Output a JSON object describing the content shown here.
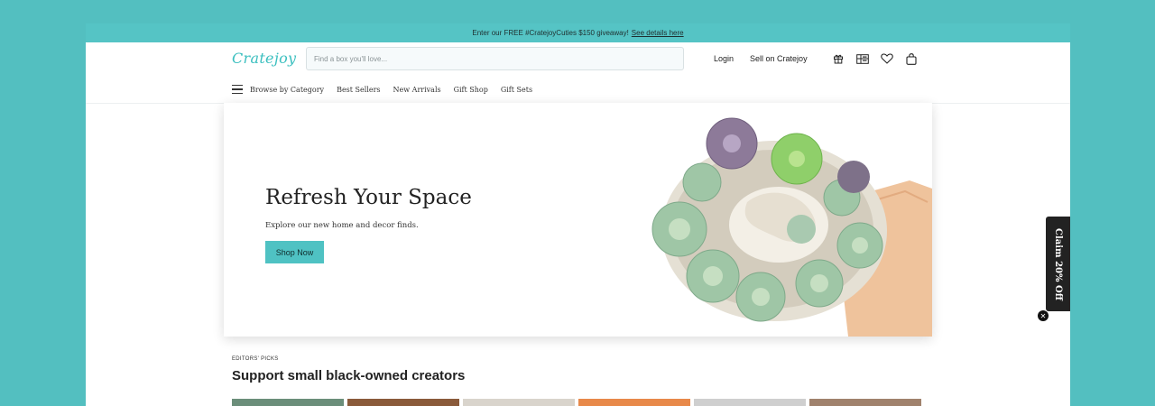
{
  "promo": {
    "text": "Enter our FREE #CratejoyCuties $150 giveaway!",
    "link": "See details here"
  },
  "header": {
    "logo": "Cratejoy",
    "search_placeholder": "Find a box you'll love...",
    "login": "Login",
    "sell": "Sell on Cratejoy",
    "icons": [
      "gift-icon",
      "gift-card-icon",
      "heart-icon",
      "bag-icon"
    ]
  },
  "nav": {
    "items": [
      "Browse by Category",
      "Best Sellers",
      "New Arrivals",
      "Gift Shop",
      "Gift Sets"
    ]
  },
  "hero": {
    "title": "Refresh Your Space",
    "subtitle": "Explore our new home and decor finds.",
    "button": "Shop Now"
  },
  "popup": {
    "label": "Claim 20% Off"
  },
  "section": {
    "eyebrow": "EDITORS' PICKS",
    "title": "Support small black-owned creators"
  },
  "colors": {
    "accent": "#55c4c5",
    "background": "#53bfc0",
    "button": "#4fc2c3",
    "claim_tab": "#222222"
  },
  "thumb_colors": [
    "#6b8e7a",
    "#8a5a3a",
    "#d9d4cc",
    "#e8894a",
    "#cfcfcf",
    "#a0826d"
  ]
}
